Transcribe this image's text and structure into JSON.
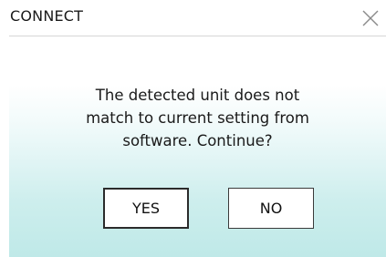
{
  "window": {
    "title": "CONNECT"
  },
  "icons": {
    "close": "close-icon"
  },
  "message": {
    "text": "The detected unit does not\nmatch to current setting from\nsoftware. Continue?"
  },
  "buttons": {
    "yes_label": "YES",
    "no_label": "NO"
  },
  "colors": {
    "gradient_bottom": "#bfe9e8",
    "text": "#1a1a1a"
  }
}
